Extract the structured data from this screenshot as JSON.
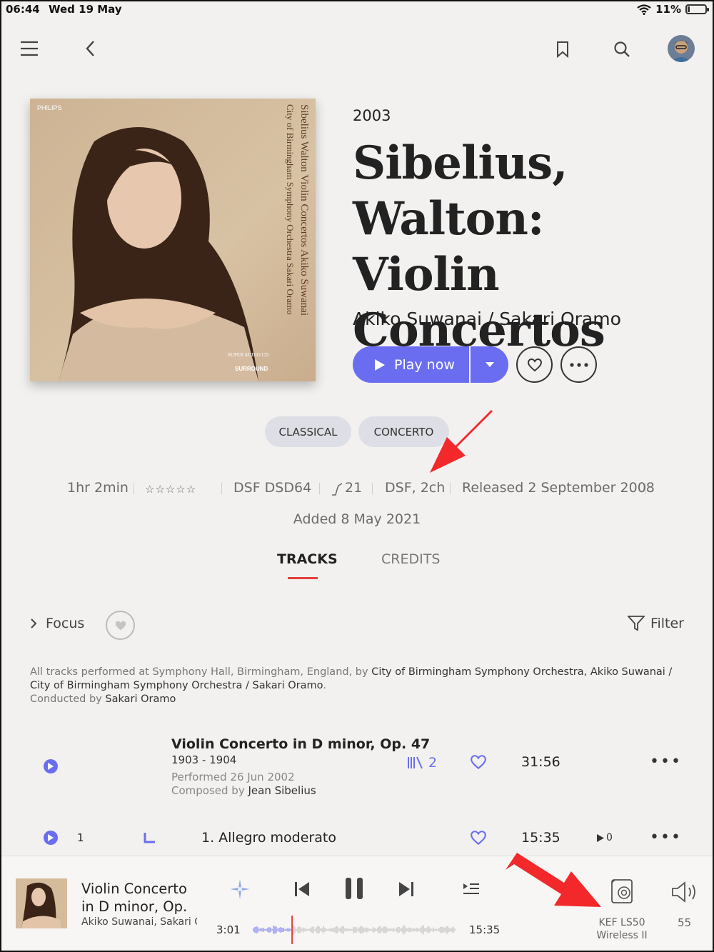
{
  "status_bar": {
    "time": "06:44",
    "date": "Wed 19 May",
    "battery": "11%"
  },
  "album": {
    "year": "2003",
    "title": "Sibelius, Walton: Violin Concertos",
    "artist": "Akiko Suwanai / Sakari Oramo",
    "cover_text": {
      "label": "PHILIPS",
      "line1": "Sibelius Walton Violin Concertos  Akiko Suwanai",
      "line2": "City of Birmingham Symphony Orchestra Sakari Oramo",
      "sacd": "SUPER AUDIO CD",
      "surround": "SURROUND"
    }
  },
  "actions": {
    "play_now": "Play now"
  },
  "genres": [
    "CLASSICAL",
    "CONCERTO"
  ],
  "meta": {
    "duration": "1hr 2min",
    "rating": "☆☆☆☆☆",
    "format": "DSF DSD64",
    "tracks": "21",
    "channels": "DSF, 2ch",
    "released": "Released 2 September 2008",
    "added": "Added 8 May 2021"
  },
  "tabs": {
    "tracks": "TRACKS",
    "credits": "CREDITS"
  },
  "toolbar": {
    "focus": "Focus",
    "filter": "Filter"
  },
  "performance_note": {
    "prefix": "All tracks performed at Symphony Hall, Birmingham, England, by ",
    "performers": "City of Birmingham Symphony Orchestra, Akiko Suwanai / City of Birmingham Symphony Orchestra / Sakari Oramo",
    "suffix": ".",
    "conducted_label": "Conducted by ",
    "conductor": "Sakari Oramo"
  },
  "work": {
    "title": "Violin Concerto in D minor, Op. 47",
    "years": "1903 - 1904",
    "performed": "Performed 26 Jun 2002",
    "composed_label": "Composed by ",
    "composer": "Jean Sibelius",
    "versions": "2",
    "duration": "31:56"
  },
  "tracks": [
    {
      "number": "1",
      "title": "1. Allegro moderato",
      "duration": "15:35",
      "plays": "0"
    }
  ],
  "player": {
    "title": "Violin Concerto in D minor, Op.",
    "artist": "Akiko Suwanai, Sakari Oramo",
    "elapsed": "3:01",
    "total": "15:35",
    "progress": 0.194,
    "device": "KEF LS50 Wireless II",
    "volume": "55"
  },
  "colors": {
    "accent": "#6b6df0",
    "tab_underline": "#e0413a",
    "annotation_arrow": "#f2282a"
  }
}
